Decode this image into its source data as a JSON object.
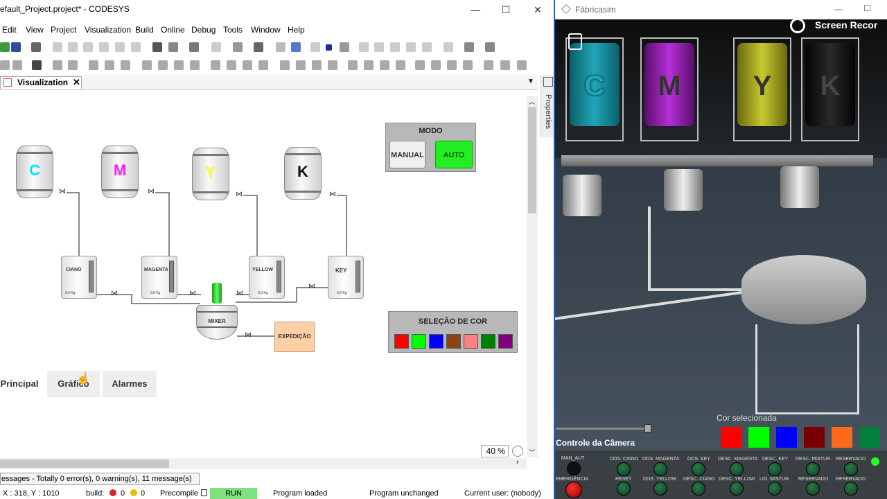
{
  "codesys": {
    "title": "efault_Project.project* - CODESYS",
    "window_controls": {
      "minimize": "—",
      "maximize": "☐",
      "close": "✕"
    },
    "menu": [
      "Edit",
      "View",
      "Project",
      "Visualization",
      "Build",
      "Online",
      "Debug",
      "Tools",
      "Window",
      "Help"
    ],
    "tab": {
      "label": "Visualization",
      "close": "✕"
    },
    "properties_label": "Properties",
    "visu": {
      "tanks": [
        {
          "letter": "C",
          "color": "#00e5ff"
        },
        {
          "letter": "M",
          "color": "#ff1aff"
        },
        {
          "letter": "Y",
          "color": "#ffff33"
        },
        {
          "letter": "K",
          "color": "#111111"
        }
      ],
      "dosers": [
        {
          "name": "CIANO",
          "weight": "0.0 Kg"
        },
        {
          "name": "MAGENTA",
          "weight": "0.0 Kg"
        },
        {
          "name": "YELLOW",
          "weight": "0.0 Kg"
        },
        {
          "name": "KEY",
          "weight": "0.0 Kg"
        }
      ],
      "mixer_label": "MIXER",
      "expedicao_label": "EXPEDIÇÃO",
      "modo": {
        "title": "MODO",
        "manual": "MANUAL",
        "auto": "AUTO"
      },
      "selecao": {
        "title": "SELEÇÃO DE COR",
        "colors": [
          "#ff0000",
          "#00ff00",
          "#0000ff",
          "#8b4513",
          "#ff8080",
          "#008000",
          "#800080"
        ]
      },
      "nav": [
        "Principal",
        "Gráfico",
        "Alarmes"
      ],
      "zoom": "40 %"
    },
    "messages": "essages - Totally 0 error(s), 0 warning(s), 11 message(s)",
    "status": {
      "coords": "X : 318, Y : 1010",
      "build_label": "build:",
      "errors": "0",
      "warnings": "0",
      "precompile": "Precompile",
      "run": "RUN",
      "program_loaded": "Program loaded",
      "program_unchanged": "Program unchanged",
      "user": "Current user: (nobody)"
    }
  },
  "fabricasim": {
    "title": "Fábricasim",
    "watermark": "Screen Recor",
    "silos": [
      {
        "letter": "C",
        "color": "#1fa6b8"
      },
      {
        "letter": "M",
        "color": "#9b1fb8"
      },
      {
        "letter": "Y",
        "color": "#b8b81f"
      },
      {
        "letter": "K",
        "color": "#1a1a1a"
      }
    ],
    "camera_control": "Controle da Câmera",
    "cor_selecionada": "Cor selecionada",
    "cor_colors": [
      "#ff0000",
      "#00ff00",
      "#0000ff",
      "#7a0000",
      "#ff6a1a",
      "#00803a"
    ],
    "controls_top": [
      "MAN_AUT",
      "DOS. CIANO",
      "DOS. MAGENTA",
      "DOS. KEY",
      "DESC. MAGENTA",
      "DESC. KEY",
      "DESC. MISTUR.",
      "RESERVADO"
    ],
    "controls_bottom": [
      "EMERGÊNCIA",
      "RESET",
      "DOS. YELLOW",
      "DESC. CIANO",
      "DESC. YELLOW",
      "LIG. MISTUR.",
      "RESERVADO",
      "RESERVADO"
    ]
  }
}
